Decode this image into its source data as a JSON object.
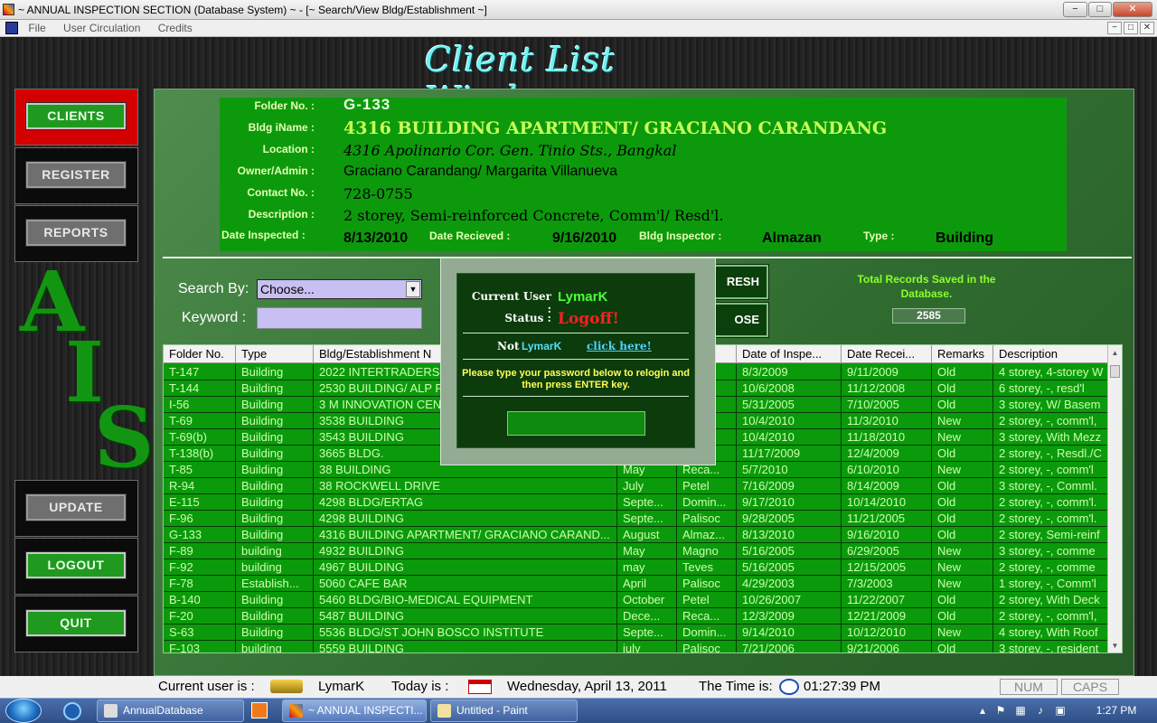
{
  "window": {
    "title": "~ ANNUAL INSPECTION SECTION (Database System) ~ - [~ Search/View Bldg/Establishment ~]",
    "controls": {
      "minimize": "−",
      "maximize": "□",
      "close": "✕"
    }
  },
  "menu": {
    "items": [
      "File",
      "User Circulation",
      "Credits"
    ]
  },
  "page_title": "Client List Window",
  "sidebar": {
    "clients": "CLIENTS",
    "register": "REGISTER",
    "reports": "REPORTS",
    "update": "UPDATE",
    "logout": "LOGOUT",
    "quit": "QUIT",
    "logo_letters": [
      "A",
      "I",
      "S"
    ]
  },
  "record": {
    "folder_label": "Folder No. :",
    "folder": "G-133",
    "name_label": "Bldg iName :",
    "name": "4316 BUILDING APARTMENT/ GRACIANO CARANDANG",
    "location_label": "Location :",
    "location": "4316 Apolinario Cor. Gen. Tinio Sts., Bangkal",
    "owner_label": "Owner/Admin :",
    "owner": "Graciano Carandang/ Margarita Villanueva",
    "contact_label": "Contact No. :",
    "contact": "728-0755",
    "desc_label": "Description :",
    "desc": "2 storey, Semi-reinforced Concrete, Comm'l/ Resd'l.",
    "inspected_label": "Date Inspected :",
    "inspected": "8/13/2010",
    "received_label": "Date Recieved :",
    "received": "9/16/2010",
    "inspector_label": "Bldg Inspector :",
    "inspector": "Almazan",
    "type_label": "Type :",
    "type": "Building"
  },
  "search": {
    "by_label": "Search By:",
    "by_value": "Choose...",
    "keyword_label": "Keyword :",
    "keyword_value": "",
    "refresh_partial": "RESH",
    "close_partial": "OSE",
    "total_label": "Total Records Saved in the Database.",
    "total_value": "2585"
  },
  "grid": {
    "columns": [
      "Folder No.",
      "Type",
      "Bldg/Establishment N",
      "",
      "",
      "Date of Inspe...",
      "Date Recei...",
      "Remarks",
      "Description"
    ],
    "rows": [
      [
        "T-147",
        "Building",
        "2022 INTERTRADERS IN",
        "",
        "...",
        "8/3/2009",
        "9/11/2009",
        "Old",
        "4 storey, 4-storey W"
      ],
      [
        "T-144",
        "Building",
        "2530 BUILDING/ ALP F",
        "",
        "...",
        "10/6/2008",
        "11/12/2008",
        "Old",
        "6 storey, -, resd'l"
      ],
      [
        "I-56",
        "Building",
        "3 M INNOVATION CEN",
        "",
        "r",
        "5/31/2005",
        "7/10/2005",
        "Old",
        "3 storey, W/ Basem"
      ],
      [
        "T-69",
        "Building",
        "3538 BUILDING",
        "",
        "...",
        "10/4/2010",
        "11/3/2010",
        "New",
        "2 storey, -, comm'l,"
      ],
      [
        "T-69(b)",
        "Building",
        "3543 BUILDING",
        "",
        "...",
        "10/4/2010",
        "11/18/2010",
        "New",
        "3 storey, With Mezz"
      ],
      [
        "T-138(b)",
        "Building",
        "3665 BLDG.",
        "",
        "...",
        "11/17/2009",
        "12/4/2009",
        "Old",
        "2 storey, -, Resdl./C"
      ],
      [
        "T-85",
        "Building",
        "38 BUILDING",
        "May",
        "Reca...",
        "5/7/2010",
        "6/10/2010",
        "New",
        "2 storey, -, comm'l"
      ],
      [
        "R-94",
        "Building",
        "38 ROCKWELL DRIVE",
        "July",
        "Petel",
        "7/16/2009",
        "8/14/2009",
        "Old",
        "3 storey, -, Comml."
      ],
      [
        "E-115",
        "Building",
        "4298 BLDG/ERTAG",
        "Septe...",
        "Domin...",
        "9/17/2010",
        "10/14/2010",
        "Old",
        "2 storey, -, comm'l."
      ],
      [
        "F-96",
        "Building",
        "4298 BUILDING",
        "Septe...",
        "Palisoc",
        "9/28/2005",
        "11/21/2005",
        "Old",
        "2 storey, -, comm'l."
      ],
      [
        "G-133",
        "Building",
        "4316 BUILDING APARTMENT/ GRACIANO CARAND...",
        "August",
        "Almaz...",
        "8/13/2010",
        "9/16/2010",
        "Old",
        "2 storey, Semi-reinf"
      ],
      [
        "F-89",
        "building",
        "4932 BUILDING",
        "May",
        "Magno",
        "5/16/2005",
        "6/29/2005",
        "New",
        "3 storey, -, comme"
      ],
      [
        "F-92",
        "building",
        "4967 BUILDING",
        "may",
        "Teves",
        "5/16/2005",
        "12/15/2005",
        "New",
        "2 storey, -, comme"
      ],
      [
        "F-78",
        "Establish...",
        "5060 CAFE BAR",
        "April",
        "Palisoc",
        "4/29/2003",
        "7/3/2003",
        "New",
        "1 storey, -, Comm'l"
      ],
      [
        "B-140",
        "Building",
        "5460 BLDG/BIO-MEDICAL EQUIPMENT",
        "October",
        "Petel",
        "10/26/2007",
        "11/22/2007",
        "Old",
        "2 storey, With Deck"
      ],
      [
        "F-20",
        "Building",
        "5487 BUILDING",
        "Dece...",
        "Reca...",
        "12/3/2009",
        "12/21/2009",
        "Old",
        "2 storey, -, comm'l,"
      ],
      [
        "S-63",
        "Building",
        "5536 BLDG/ST JOHN BOSCO INSTITUTE",
        "Septe...",
        "Domin...",
        "9/14/2010",
        "10/12/2010",
        "New",
        "4 storey, With Roof"
      ],
      [
        "F-103",
        "building",
        "5559 BUILDING",
        "july",
        "Palisoc",
        "7/21/2006",
        "9/21/2006",
        "Old",
        "3 storey, -, resident"
      ]
    ]
  },
  "dialog": {
    "current_user_label": "Current User :",
    "current_user": "LymarK",
    "status_label": "Status :",
    "status": "Logoff!",
    "not_label": "Not",
    "not_user": "LymarK",
    "link": "click here!",
    "instruction": "Please type your password below to relogin and then press ENTER key.",
    "password": ""
  },
  "statusbar": {
    "user_label": "Current user is :",
    "user": "LymarK",
    "today_label": "Today is :",
    "today": "Wednesday, April 13, 2011",
    "time_label": "The Time is:",
    "time": "01:27:39 PM",
    "num": "NUM",
    "caps": "CAPS"
  },
  "taskbar": {
    "items": [
      "AnnualDatabase",
      "~ ANNUAL INSPECTI...",
      "Untitled - Paint"
    ],
    "clock": "1:27 PM"
  },
  "colors": {
    "accent_green": "#0c9a0c",
    "title_cyan": "#6ef2f2",
    "status_red": "#ff2020"
  }
}
